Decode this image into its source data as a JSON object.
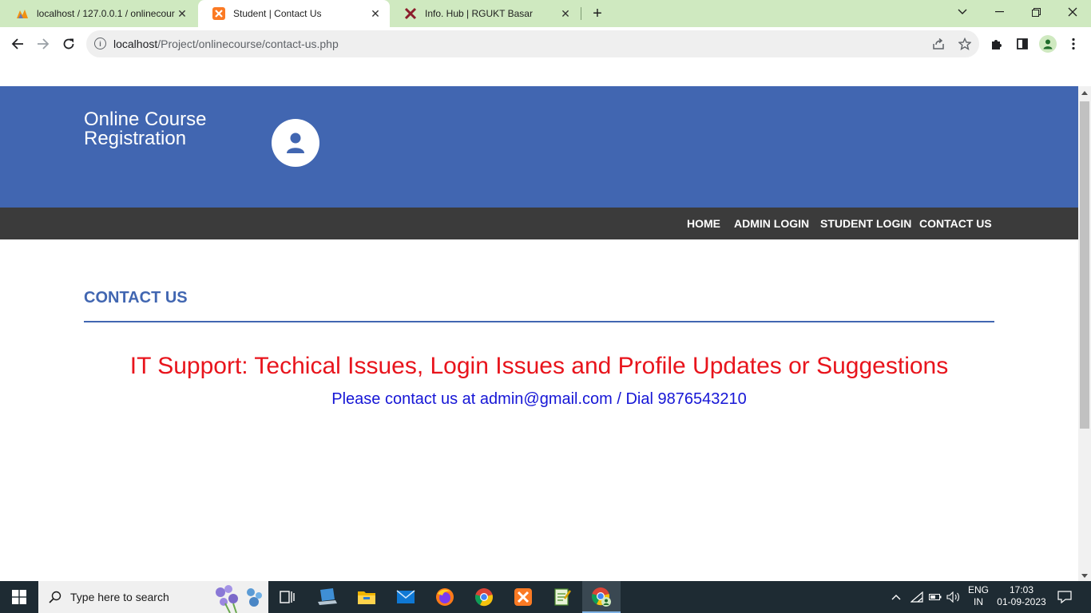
{
  "browser": {
    "tabs": [
      {
        "title": "localhost / 127.0.0.1 / onlinecour",
        "icon": "phpmyadmin-icon",
        "active": false
      },
      {
        "title": "Student | Contact Us",
        "icon": "xampp-icon",
        "active": true
      },
      {
        "title": "Info. Hub | RGUKT Basar",
        "icon": "rgukt-icon",
        "active": false
      }
    ],
    "url_host": "localhost",
    "url_path": "/Project/onlinecourse/contact-us.php"
  },
  "site": {
    "brand_line1": "Online Course",
    "brand_line2": "Registration",
    "nav": [
      "HOME",
      "ADMIN LOGIN",
      "STUDENT LOGIN",
      "CONTACT US"
    ]
  },
  "content": {
    "section_title": "CONTACT US",
    "support_text": "IT Support: Techical Issues, Login Issues and Profile Updates or Suggestions",
    "contact_text": "Please contact us at admin@gmail.com / Dial 9876543210"
  },
  "taskbar": {
    "search_placeholder": "Type here to search",
    "apps": [
      "task-view-icon",
      "laptop-icon",
      "file-explorer-icon",
      "mail-icon",
      "firefox-icon",
      "chrome-icon",
      "xampp-icon",
      "notepad-icon",
      "chrome-profile-icon"
    ],
    "lang_top": "ENG",
    "lang_bottom": "IN",
    "time": "17:03",
    "date": "01-09-2023"
  },
  "colors": {
    "header_blue": "#4166b1",
    "navbar": "#3b3b3b",
    "support_red": "#e8141c",
    "contact_blue": "#1616d6",
    "tabstrip_green": "#cfe9c0"
  }
}
